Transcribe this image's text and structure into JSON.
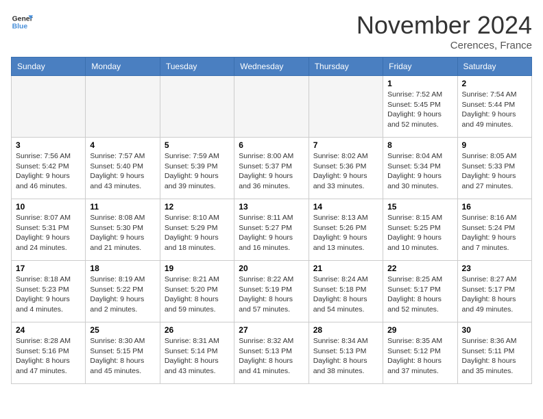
{
  "header": {
    "logo_general": "General",
    "logo_blue": "Blue",
    "month_title": "November 2024",
    "location": "Cerences, France"
  },
  "days_of_week": [
    "Sunday",
    "Monday",
    "Tuesday",
    "Wednesday",
    "Thursday",
    "Friday",
    "Saturday"
  ],
  "weeks": [
    [
      {
        "day": "",
        "info": ""
      },
      {
        "day": "",
        "info": ""
      },
      {
        "day": "",
        "info": ""
      },
      {
        "day": "",
        "info": ""
      },
      {
        "day": "",
        "info": ""
      },
      {
        "day": "1",
        "info": "Sunrise: 7:52 AM\nSunset: 5:45 PM\nDaylight: 9 hours and 52 minutes."
      },
      {
        "day": "2",
        "info": "Sunrise: 7:54 AM\nSunset: 5:44 PM\nDaylight: 9 hours and 49 minutes."
      }
    ],
    [
      {
        "day": "3",
        "info": "Sunrise: 7:56 AM\nSunset: 5:42 PM\nDaylight: 9 hours and 46 minutes."
      },
      {
        "day": "4",
        "info": "Sunrise: 7:57 AM\nSunset: 5:40 PM\nDaylight: 9 hours and 43 minutes."
      },
      {
        "day": "5",
        "info": "Sunrise: 7:59 AM\nSunset: 5:39 PM\nDaylight: 9 hours and 39 minutes."
      },
      {
        "day": "6",
        "info": "Sunrise: 8:00 AM\nSunset: 5:37 PM\nDaylight: 9 hours and 36 minutes."
      },
      {
        "day": "7",
        "info": "Sunrise: 8:02 AM\nSunset: 5:36 PM\nDaylight: 9 hours and 33 minutes."
      },
      {
        "day": "8",
        "info": "Sunrise: 8:04 AM\nSunset: 5:34 PM\nDaylight: 9 hours and 30 minutes."
      },
      {
        "day": "9",
        "info": "Sunrise: 8:05 AM\nSunset: 5:33 PM\nDaylight: 9 hours and 27 minutes."
      }
    ],
    [
      {
        "day": "10",
        "info": "Sunrise: 8:07 AM\nSunset: 5:31 PM\nDaylight: 9 hours and 24 minutes."
      },
      {
        "day": "11",
        "info": "Sunrise: 8:08 AM\nSunset: 5:30 PM\nDaylight: 9 hours and 21 minutes."
      },
      {
        "day": "12",
        "info": "Sunrise: 8:10 AM\nSunset: 5:29 PM\nDaylight: 9 hours and 18 minutes."
      },
      {
        "day": "13",
        "info": "Sunrise: 8:11 AM\nSunset: 5:27 PM\nDaylight: 9 hours and 16 minutes."
      },
      {
        "day": "14",
        "info": "Sunrise: 8:13 AM\nSunset: 5:26 PM\nDaylight: 9 hours and 13 minutes."
      },
      {
        "day": "15",
        "info": "Sunrise: 8:15 AM\nSunset: 5:25 PM\nDaylight: 9 hours and 10 minutes."
      },
      {
        "day": "16",
        "info": "Sunrise: 8:16 AM\nSunset: 5:24 PM\nDaylight: 9 hours and 7 minutes."
      }
    ],
    [
      {
        "day": "17",
        "info": "Sunrise: 8:18 AM\nSunset: 5:23 PM\nDaylight: 9 hours and 4 minutes."
      },
      {
        "day": "18",
        "info": "Sunrise: 8:19 AM\nSunset: 5:22 PM\nDaylight: 9 hours and 2 minutes."
      },
      {
        "day": "19",
        "info": "Sunrise: 8:21 AM\nSunset: 5:20 PM\nDaylight: 8 hours and 59 minutes."
      },
      {
        "day": "20",
        "info": "Sunrise: 8:22 AM\nSunset: 5:19 PM\nDaylight: 8 hours and 57 minutes."
      },
      {
        "day": "21",
        "info": "Sunrise: 8:24 AM\nSunset: 5:18 PM\nDaylight: 8 hours and 54 minutes."
      },
      {
        "day": "22",
        "info": "Sunrise: 8:25 AM\nSunset: 5:17 PM\nDaylight: 8 hours and 52 minutes."
      },
      {
        "day": "23",
        "info": "Sunrise: 8:27 AM\nSunset: 5:17 PM\nDaylight: 8 hours and 49 minutes."
      }
    ],
    [
      {
        "day": "24",
        "info": "Sunrise: 8:28 AM\nSunset: 5:16 PM\nDaylight: 8 hours and 47 minutes."
      },
      {
        "day": "25",
        "info": "Sunrise: 8:30 AM\nSunset: 5:15 PM\nDaylight: 8 hours and 45 minutes."
      },
      {
        "day": "26",
        "info": "Sunrise: 8:31 AM\nSunset: 5:14 PM\nDaylight: 8 hours and 43 minutes."
      },
      {
        "day": "27",
        "info": "Sunrise: 8:32 AM\nSunset: 5:13 PM\nDaylight: 8 hours and 41 minutes."
      },
      {
        "day": "28",
        "info": "Sunrise: 8:34 AM\nSunset: 5:13 PM\nDaylight: 8 hours and 38 minutes."
      },
      {
        "day": "29",
        "info": "Sunrise: 8:35 AM\nSunset: 5:12 PM\nDaylight: 8 hours and 37 minutes."
      },
      {
        "day": "30",
        "info": "Sunrise: 8:36 AM\nSunset: 5:11 PM\nDaylight: 8 hours and 35 minutes."
      }
    ]
  ]
}
